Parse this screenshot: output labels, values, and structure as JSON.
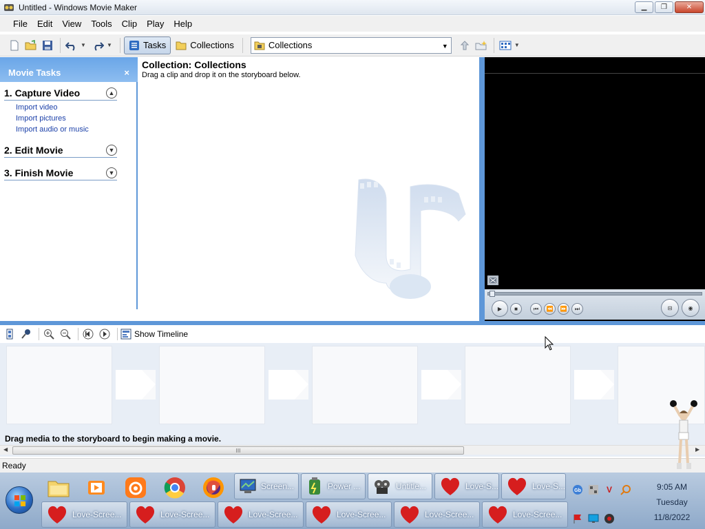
{
  "window": {
    "title": "Untitled - Windows Movie Maker"
  },
  "menu": [
    "File",
    "Edit",
    "View",
    "Tools",
    "Clip",
    "Play",
    "Help"
  ],
  "toolbar": {
    "tasks_label": "Tasks",
    "collections_label": "Collections",
    "collection_dropdown_value": "Collections"
  },
  "task_pane": {
    "title": "Movie Tasks",
    "close_glyph": "×",
    "groups": [
      {
        "label": "1. Capture Video",
        "expanded": true,
        "links": [
          "Import video",
          "Import pictures",
          "Import audio or music"
        ]
      },
      {
        "label": "2. Edit Movie",
        "expanded": false,
        "links": []
      },
      {
        "label": "3. Finish Movie",
        "expanded": false,
        "links": []
      }
    ]
  },
  "collection": {
    "title": "Collection: Collections",
    "subtitle": "Drag a clip and drop it on the storyboard below."
  },
  "storyboard": {
    "toolbar": {
      "show_timeline_label": "Show Timeline"
    },
    "hint": "Drag media to the storyboard to begin making a movie.",
    "scroll_glyph": "III"
  },
  "status": {
    "text": "Ready"
  },
  "taskbar": {
    "pinned": [
      "file-explorer",
      "media-player",
      "uc-browser",
      "chrome",
      "firefox"
    ],
    "buttons_row1": [
      {
        "label": "Screen...",
        "icon": "screen-icon"
      },
      {
        "label": "Power ...",
        "icon": "power-icon"
      },
      {
        "label": "Untitle...",
        "icon": "moviemaker-icon",
        "active": true
      },
      {
        "label": "Love-S...",
        "icon": "heart-icon"
      },
      {
        "label": "Love-S...",
        "icon": "heart-icon"
      }
    ],
    "buttons_row2": [
      {
        "label": "Love-Scree...",
        "icon": "heart-icon"
      },
      {
        "label": "Love-Scree...",
        "icon": "heart-icon"
      },
      {
        "label": "Love-Scree...",
        "icon": "heart-icon"
      },
      {
        "label": "Love-Scree...",
        "icon": "heart-icon"
      },
      {
        "label": "Love-Scree...",
        "icon": "heart-icon"
      },
      {
        "label": "Love-Scree...",
        "icon": "heart-icon"
      }
    ],
    "tray_v_glyph": "V",
    "clock": {
      "time": "9:05 AM",
      "day": "Tuesday",
      "date": "11/8/2022"
    }
  },
  "colors": {
    "accent_blue": "#5e97d8",
    "heart_red": "#d61e1e",
    "link_blue": "#1a3fa8"
  }
}
